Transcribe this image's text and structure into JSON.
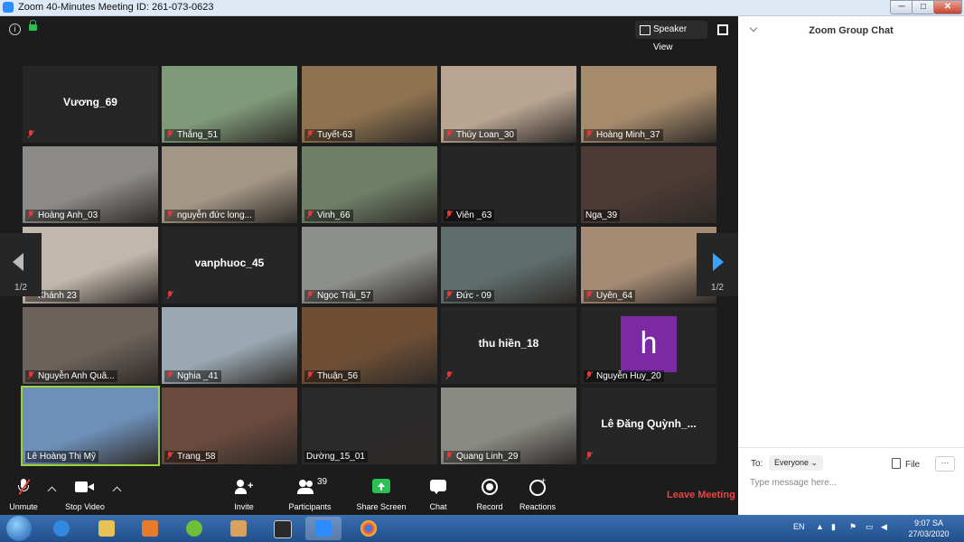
{
  "window": {
    "title": "Zoom 40-Minutes Meeting ID: 261-073-0623",
    "min": "─",
    "max": "□",
    "close": "✕"
  },
  "view": {
    "speaker_view_label": "Speaker View"
  },
  "pagination": {
    "left": "1/2",
    "right": "1/2"
  },
  "participants_grid": [
    {
      "name": "Vương_69",
      "video": false,
      "muted": true
    },
    {
      "name": "Thắng_51",
      "video": true,
      "muted": true,
      "color": "#7f9a78"
    },
    {
      "name": "Tuyết-63",
      "video": true,
      "muted": true,
      "color": "#8f7350"
    },
    {
      "name": "Thúy Loan_30",
      "video": true,
      "muted": true,
      "color": "#b9a592"
    },
    {
      "name": "Hoàng Minh_37",
      "video": true,
      "muted": true,
      "color": "#a58a6c"
    },
    {
      "name": "Hoàng Anh_03",
      "video": true,
      "muted": true,
      "color": "#8b8a87"
    },
    {
      "name": "nguyễn đức long...",
      "video": true,
      "muted": true,
      "color": "#a29684"
    },
    {
      "name": "Vinh_66",
      "video": true,
      "muted": true,
      "color": "#6f7f67"
    },
    {
      "name": "Viên _63",
      "video": false,
      "muted": true,
      "show_label_only": true
    },
    {
      "name": "Nga_39",
      "video": true,
      "muted": false,
      "color": "#4b3a35"
    },
    {
      "name": "Khánh 23",
      "video": true,
      "muted": true,
      "color": "#c1b7ac"
    },
    {
      "name": "vanphuoc_45",
      "video": false,
      "muted": true
    },
    {
      "name": "Ngọc Trãi_57",
      "video": true,
      "muted": true,
      "color": "#8d8f8c"
    },
    {
      "name": "Đức - 09",
      "video": true,
      "muted": true,
      "color": "#5f6d6c"
    },
    {
      "name": "Uyên_64",
      "video": true,
      "muted": true,
      "color": "#a58b74"
    },
    {
      "name": "Nguyễn Anh Quâ...",
      "video": true,
      "muted": true,
      "color": "#6c625b"
    },
    {
      "name": "Nghia _41",
      "video": true,
      "muted": true,
      "color": "#9aa8b2"
    },
    {
      "name": "Thuận_56",
      "video": true,
      "muted": true,
      "color": "#6e4f36"
    },
    {
      "name": "thu hiền_18",
      "video": false,
      "muted": true
    },
    {
      "name": "Nguyễn Huy_20",
      "video": false,
      "muted": true,
      "avatar_letter": "h"
    },
    {
      "name": "Lê Hoàng Thị Mỹ",
      "video": true,
      "muted": false,
      "color": "#6d8fb8",
      "active": true
    },
    {
      "name": "Trang_58",
      "video": true,
      "muted": true,
      "color": "#6a4a3d"
    },
    {
      "name": "Dường_15_01",
      "video": true,
      "muted": false,
      "color": "#2b2a2b"
    },
    {
      "name": "Quang Linh_29",
      "video": true,
      "muted": true,
      "color": "#8a8a84"
    },
    {
      "name": "Lê Đăng Quỳnh_...",
      "video": false,
      "muted": true
    }
  ],
  "toolbar": {
    "unmute": "Unmute",
    "stop_video": "Stop Video",
    "invite": "Invite",
    "participants": "Participants",
    "participants_count": "39",
    "share_screen": "Share Screen",
    "chat": "Chat",
    "record": "Record",
    "reactions": "Reactions",
    "leave": "Leave Meeting"
  },
  "chat_panel": {
    "title": "Zoom Group Chat",
    "to_label": "To:",
    "recipient": "Everyone",
    "file": "File",
    "more": "···",
    "placeholder": "Type message here..."
  },
  "taskbar": {
    "language": "EN",
    "time": "9:07 SA",
    "date": "27/03/2020"
  }
}
